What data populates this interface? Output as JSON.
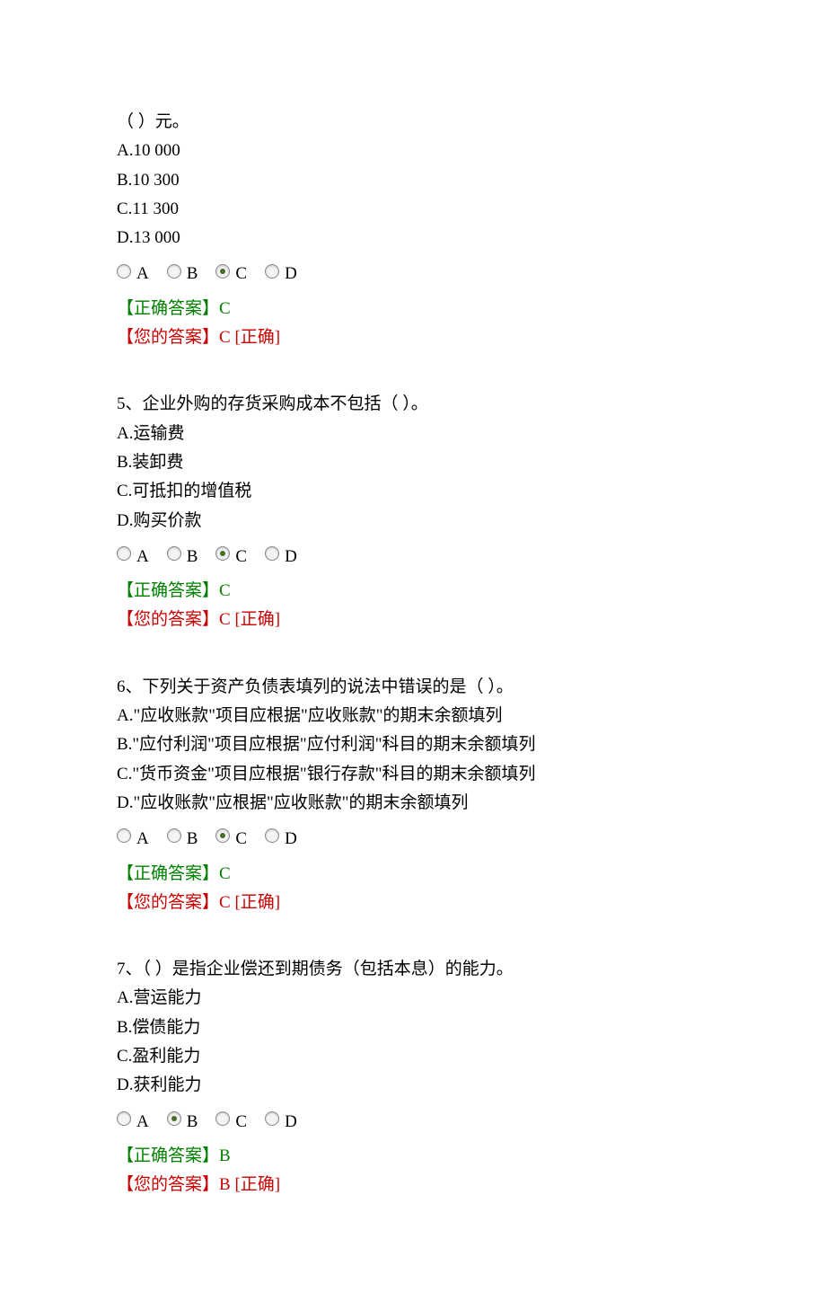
{
  "q4": {
    "stem_partial": "（  ）元。",
    "optA": "A.10 000",
    "optB": "B.10 300",
    "optC": "C.11 300",
    "optD": "D.13 000",
    "rA": "A",
    "rB": "B",
    "rC": "C",
    "rD": "D",
    "correct_label": "【正确答案】",
    "correct_value": "C",
    "your_label": "【您的答案】",
    "your_value": "C [正确]"
  },
  "q5": {
    "stem": "5、企业外购的存货采购成本不包括（  ）。",
    "optA": "A.运输费",
    "optB": "B.装卸费",
    "optC": "C.可抵扣的增值税",
    "optD": "D.购买价款",
    "rA": "A",
    "rB": "B",
    "rC": "C",
    "rD": "D",
    "correct_label": "【正确答案】",
    "correct_value": "C",
    "your_label": "【您的答案】",
    "your_value": "C [正确]"
  },
  "q6": {
    "stem": "6、下列关于资产负债表填列的说法中错误的是（  ）。",
    "optA": "A.\"应收账款\"项目应根据\"应收账款\"的期末余额填列",
    "optB": "B.\"应付利润\"项目应根据\"应付利润\"科目的期末余额填列",
    "optC": "C.\"货币资金\"项目应根据\"银行存款\"科目的期末余额填列",
    "optD": "D.\"应收账款\"应根据\"应收账款\"的期末余额填列",
    "rA": "A",
    "rB": "B",
    "rC": "C",
    "rD": "D",
    "correct_label": "【正确答案】",
    "correct_value": "C",
    "your_label": "【您的答案】",
    "your_value": "C [正确]"
  },
  "q7": {
    "stem": "7、（  ）是指企业偿还到期债务（包括本息）的能力。",
    "optA": "A.营运能力",
    "optB": "B.偿债能力",
    "optC": "C.盈利能力",
    "optD": "D.获利能力",
    "rA": "A",
    "rB": "B",
    "rC": "C",
    "rD": "D",
    "correct_label": "【正确答案】",
    "correct_value": "B",
    "your_label": "【您的答案】",
    "your_value": "B [正确]"
  }
}
